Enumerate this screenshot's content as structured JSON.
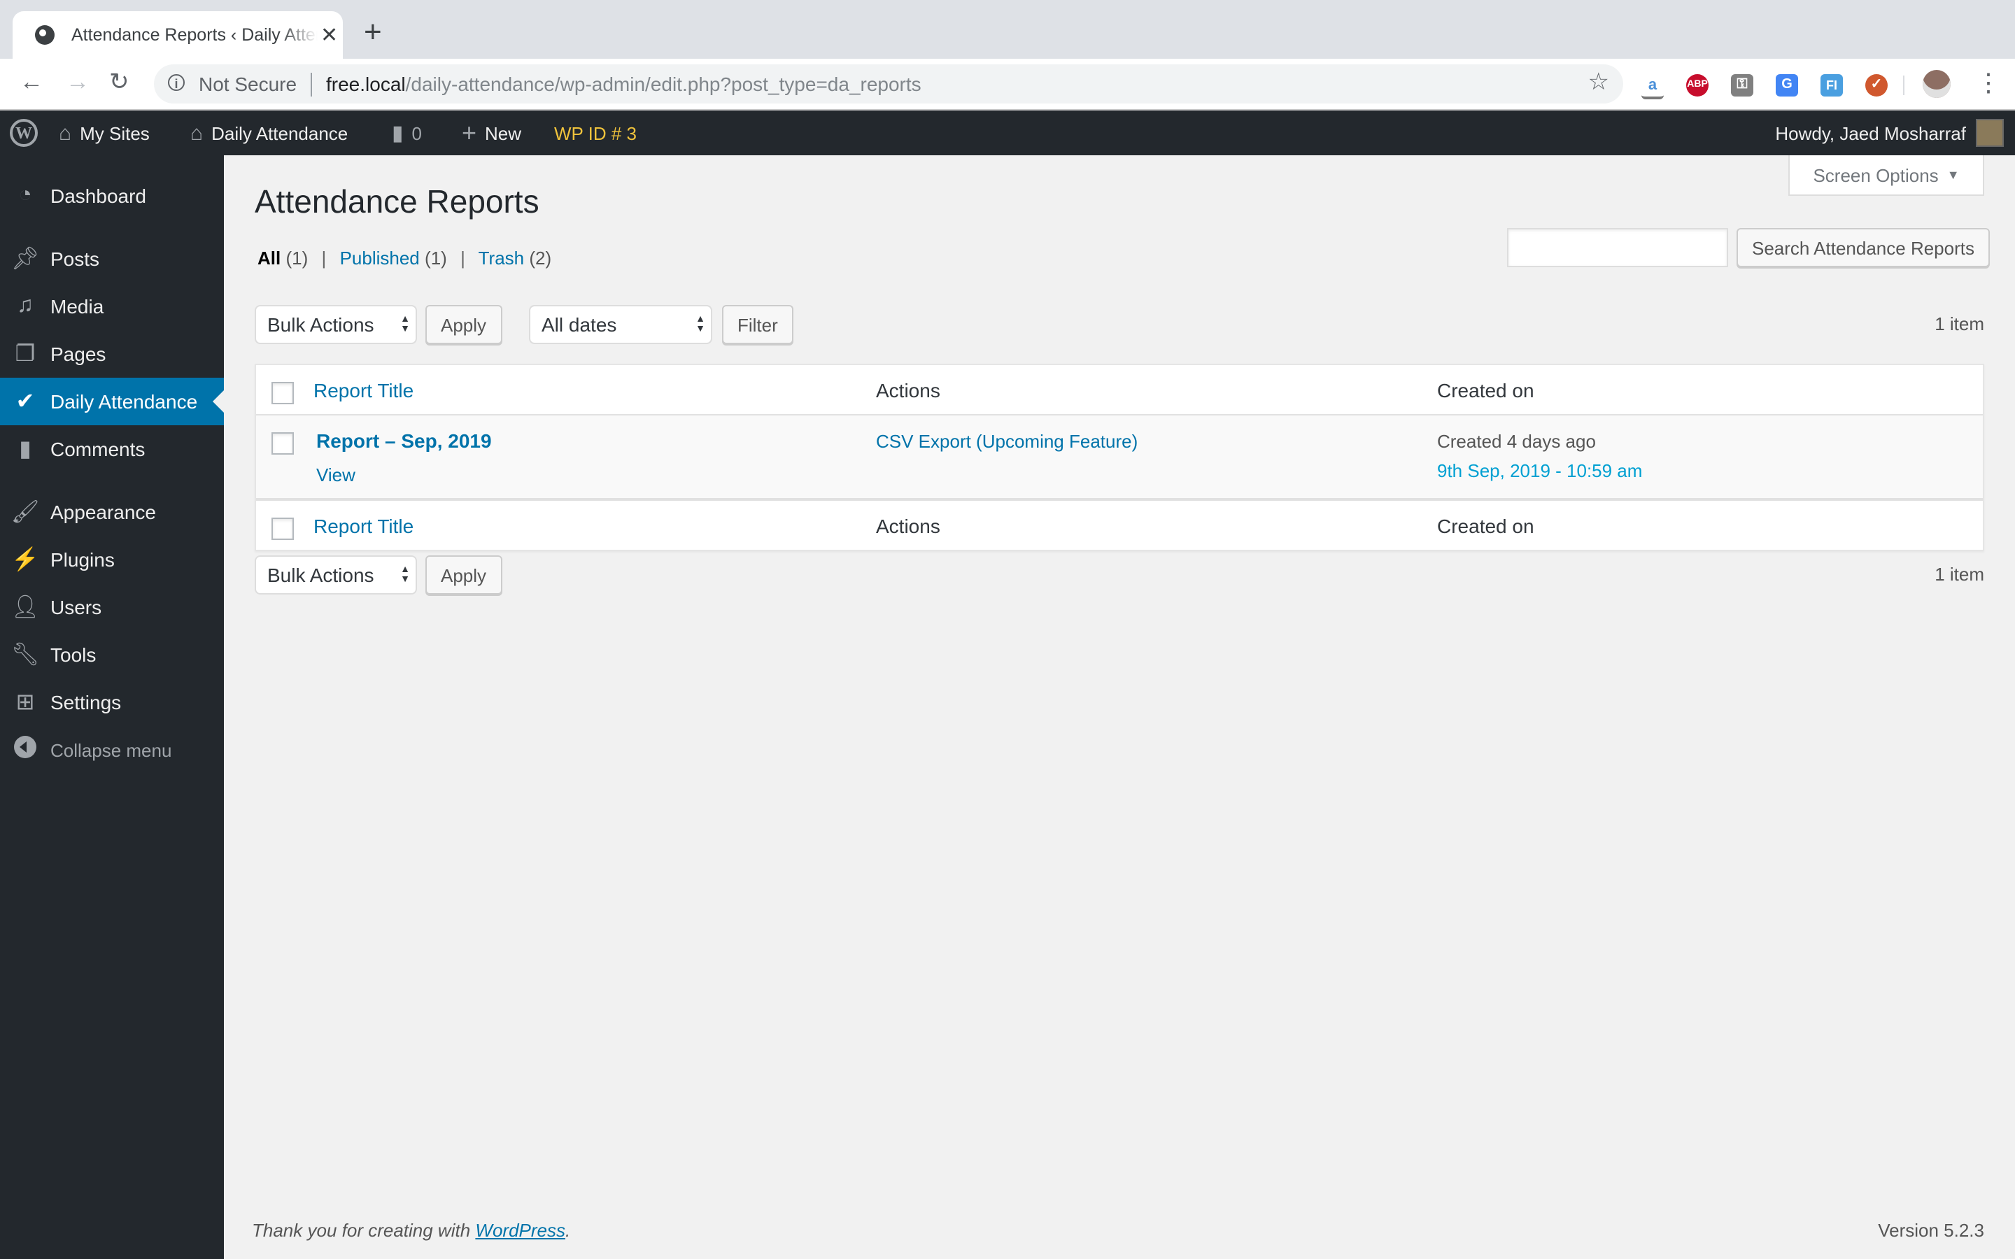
{
  "browser": {
    "tab_title": "Attendance Reports ‹ Daily Attendance",
    "security_label": "Not Secure",
    "url_host": "free.local",
    "url_path": "/daily-attendance/wp-admin/edit.php?post_type=da_reports",
    "extensions": [
      {
        "name": "amazon-assistant",
        "glyph": "a",
        "color": "#4a90d9"
      },
      {
        "name": "adblock-plus",
        "glyph": "ABP",
        "color": "#c70d2c"
      },
      {
        "name": "password-manager",
        "glyph": "⚿",
        "color": "#808080"
      },
      {
        "name": "google-translate",
        "glyph": "G",
        "color": "#4285f4"
      },
      {
        "name": "form-filler",
        "glyph": "FI",
        "color": "#4a9fe0"
      },
      {
        "name": "user-check",
        "glyph": "✓",
        "color": "#d0582e"
      }
    ]
  },
  "admin_bar": {
    "my_sites": "My Sites",
    "site_name": "Daily Attendance",
    "comments_count": "0",
    "new_label": "New",
    "wp_id": "WP ID # 3",
    "howdy": "Howdy, Jaed Mosharraf"
  },
  "sidebar": {
    "items": [
      {
        "label": "Dashboard",
        "icon": "dashboard-icon"
      },
      {
        "label": "Posts",
        "icon": "pin-icon"
      },
      {
        "label": "Media",
        "icon": "media-icon"
      },
      {
        "label": "Pages",
        "icon": "pages-icon"
      },
      {
        "label": "Daily Attendance",
        "icon": "checkmark-icon",
        "active": true
      },
      {
        "label": "Comments",
        "icon": "comment-icon"
      },
      {
        "label": "Appearance",
        "icon": "paintbrush-icon"
      },
      {
        "label": "Plugins",
        "icon": "plugin-icon"
      },
      {
        "label": "Users",
        "icon": "user-icon"
      },
      {
        "label": "Tools",
        "icon": "wrench-icon"
      },
      {
        "label": "Settings",
        "icon": "settings-icon"
      }
    ],
    "collapse_label": "Collapse menu"
  },
  "page": {
    "screen_options": "Screen Options",
    "title": "Attendance Reports",
    "views": {
      "all_label": "All",
      "all_count": "(1)",
      "published_label": "Published",
      "published_count": "(1)",
      "trash_label": "Trash",
      "trash_count": "(2)"
    },
    "search": {
      "value": "",
      "button": "Search Attendance Reports"
    },
    "top_nav": {
      "bulk_actions": "Bulk Actions",
      "apply": "Apply",
      "date_filter": "All dates",
      "filter": "Filter",
      "count": "1 item"
    },
    "bottom_nav": {
      "bulk_actions": "Bulk Actions",
      "apply": "Apply",
      "count": "1 item"
    },
    "table": {
      "columns": [
        "Report Title",
        "Actions",
        "Created on"
      ],
      "rows": [
        {
          "title": "Report – Sep, 2019",
          "row_action": "View",
          "action_link": "CSV Export (Upcoming Feature)",
          "created_ago": "Created 4 days ago",
          "created_date": "9th Sep, 2019 - 10:59 am"
        }
      ]
    },
    "footer": {
      "thanks_prefix": "Thank you for creating with ",
      "wordpress_link": "WordPress",
      "thanks_suffix": ".",
      "version": "Version 5.2.3"
    }
  },
  "colors": {
    "admin_bar_bg": "#23282d",
    "accent": "#0073aa",
    "wp_id_color": "#f0c33c",
    "date_link": "#00a0d2"
  }
}
